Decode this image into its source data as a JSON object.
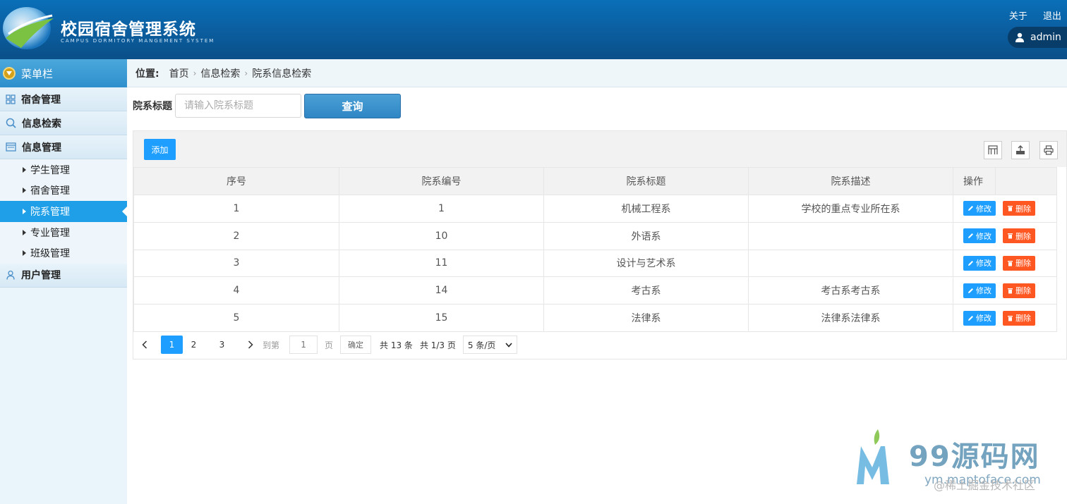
{
  "header": {
    "title": "校园宿舍管理系统",
    "subtitle": "CAMPUS DORMITORY MANGEMENT SYSTEM",
    "about": "关于",
    "logout": "退出",
    "user": "admin"
  },
  "sidebar": {
    "menu_title": "菜单栏",
    "groups": [
      {
        "label": "宿舍管理",
        "icon": "grid-icon"
      },
      {
        "label": "信息检索",
        "icon": "search-icon"
      },
      {
        "label": "信息管理",
        "icon": "window-icon"
      },
      {
        "label": "用户管理",
        "icon": "user-icon"
      }
    ],
    "sub_items": [
      "学生管理",
      "宿舍管理",
      "院系管理",
      "专业管理",
      "班级管理"
    ],
    "active_sub": "院系管理"
  },
  "breadcrumb": {
    "label": "位置:",
    "items": [
      "首页",
      "信息检索",
      "院系信息检索"
    ]
  },
  "search": {
    "label": "院系标题",
    "placeholder": "请输入院系标题",
    "button": "查询"
  },
  "toolbar": {
    "add": "添加",
    "icons": [
      "columns-icon",
      "export-icon",
      "print-icon"
    ]
  },
  "table": {
    "headers": [
      "序号",
      "院系编号",
      "院系标题",
      "院系描述",
      "操作"
    ],
    "rows": [
      [
        "1",
        "1",
        "机械工程系",
        "学校的重点专业所在系"
      ],
      [
        "2",
        "10",
        "外语系",
        ""
      ],
      [
        "3",
        "11",
        "设计与艺术系",
        ""
      ],
      [
        "4",
        "14",
        "考古系",
        "考古系考古系"
      ],
      [
        "5",
        "15",
        "法律系",
        "法律系法律系"
      ]
    ],
    "edit_label": "修改",
    "delete_label": "删除"
  },
  "pager": {
    "pages": [
      "1",
      "2",
      "3"
    ],
    "current": "1",
    "goto_label": "到第",
    "goto_value": "1",
    "page_suffix": "页",
    "confirm": "确定",
    "total": "共 13 条",
    "page_count": "共 1/3 页",
    "page_size": "5 条/页"
  },
  "watermark": {
    "text": "99源码网",
    "url": "ym.maptoface.com",
    "juejin": "@稀土掘金技术社区"
  },
  "colors": {
    "header": "#0b5d9e",
    "primary": "#1e9fff",
    "danger": "#ff5722",
    "sidebar_active": "#1e9fe8"
  }
}
